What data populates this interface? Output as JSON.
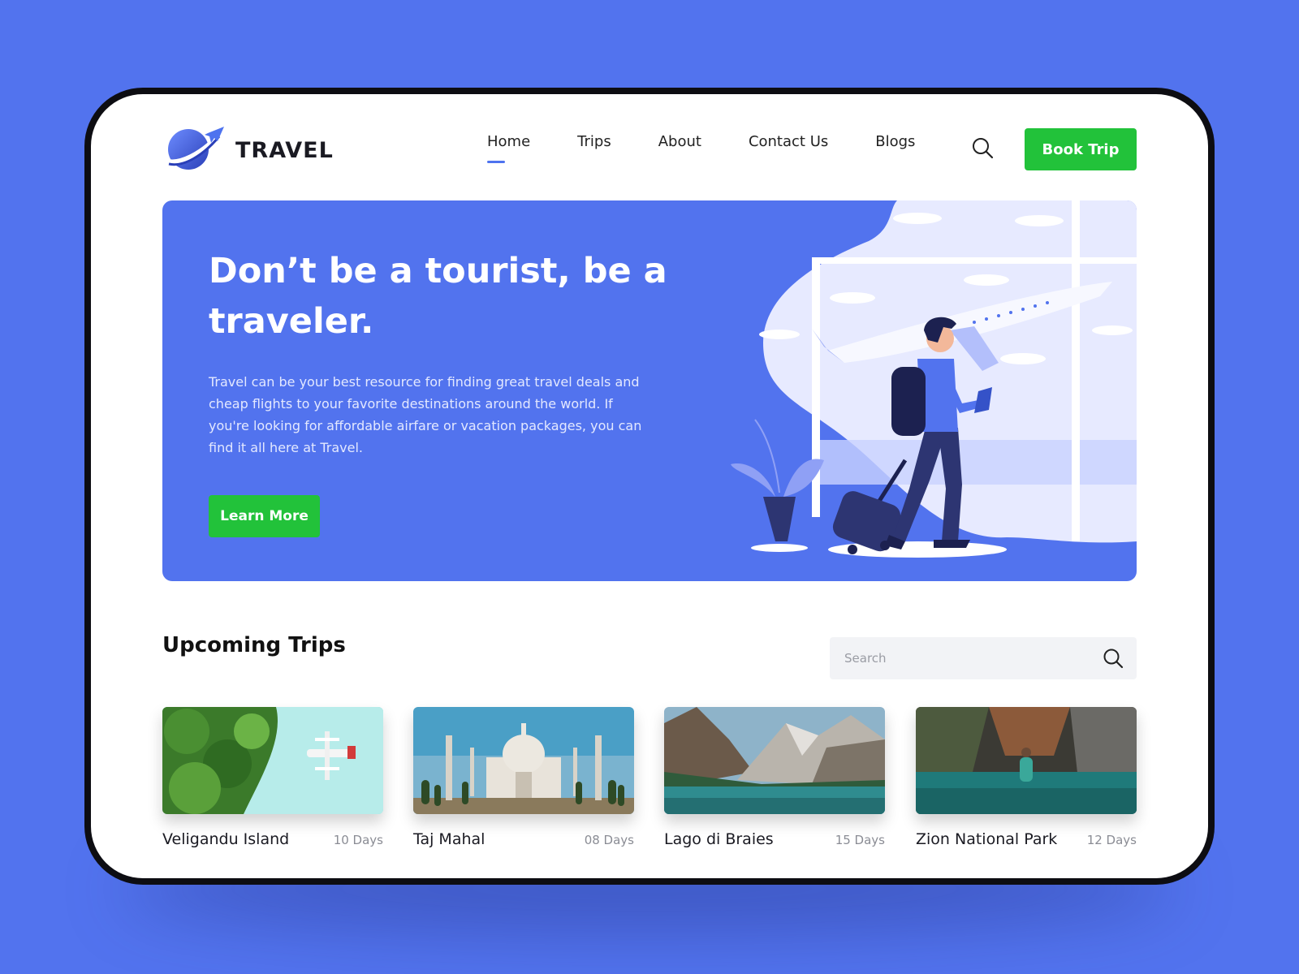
{
  "brand": {
    "name": "TRAVEL"
  },
  "nav": {
    "items": [
      "Home",
      "Trips",
      "About",
      "Contact Us",
      "Blogs"
    ],
    "active": "Home",
    "cta": "Book Trip"
  },
  "hero": {
    "title": "Don’t be a tourist, be a traveler.",
    "text": "Travel can be your best resource for finding great travel deals and cheap flights to your favorite destinations around the world. If you're looking for affordable airfare or vacation packages, you can find it all here at Travel.",
    "button": "Learn More"
  },
  "trips": {
    "title": "Upcoming Trips",
    "search_placeholder": "Search",
    "cards": [
      {
        "name": "Veligandu Island",
        "days": "10 Days"
      },
      {
        "name": "Taj Mahal",
        "days": "08 Days"
      },
      {
        "name": "Lago di Braies",
        "days": "15 Days"
      },
      {
        "name": "Zion National Park",
        "days": "12 Days"
      }
    ]
  },
  "colors": {
    "background": "#5273ee",
    "accent": "#4e73ef",
    "cta": "#22c23a"
  }
}
